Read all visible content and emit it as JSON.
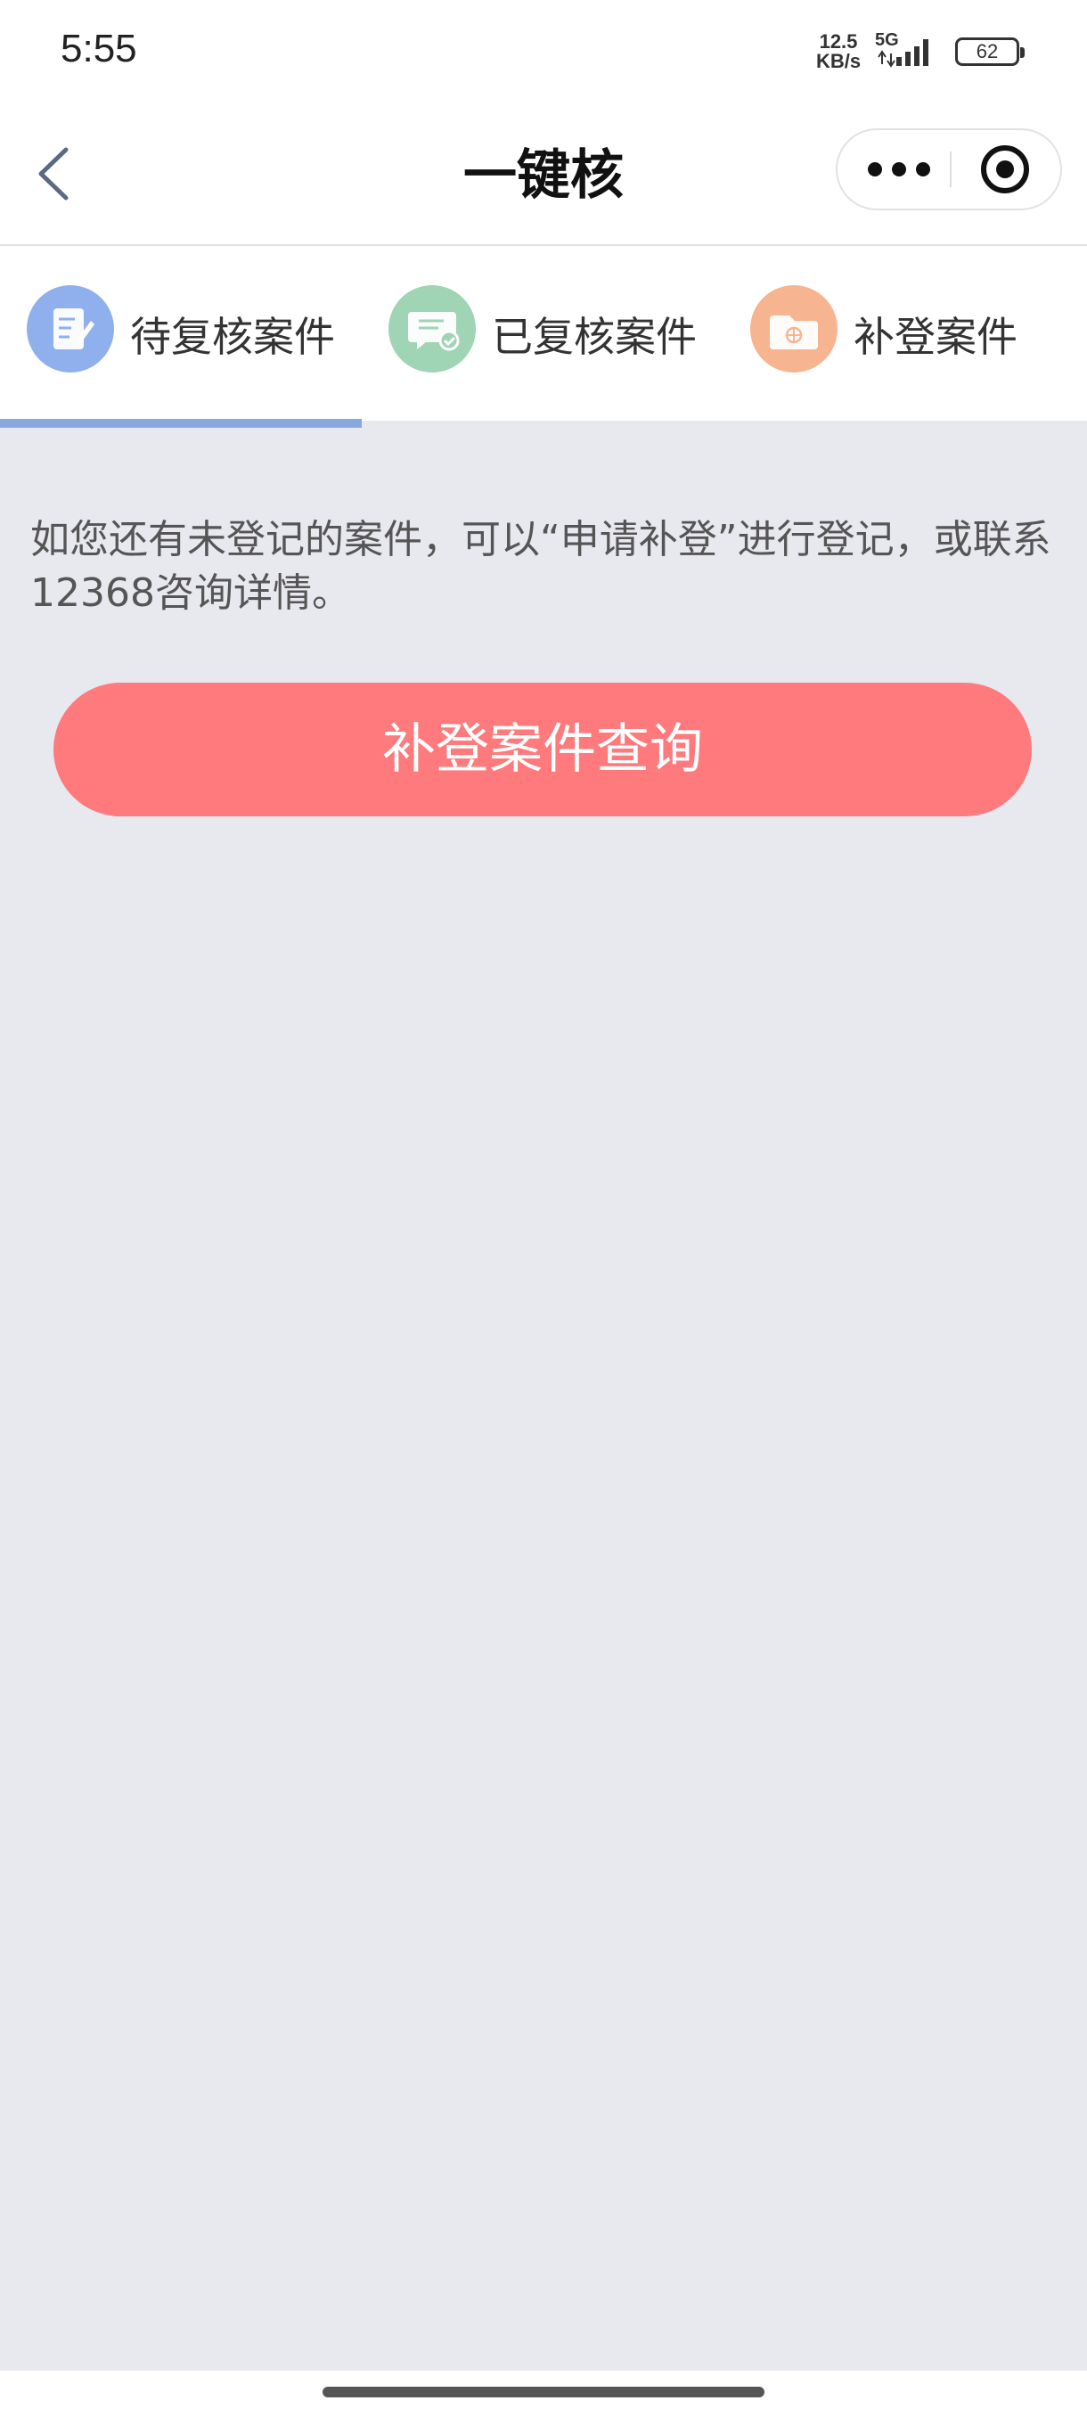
{
  "status_bar": {
    "time": "5:55",
    "net_speed_value": "12.5",
    "net_speed_unit": "KB/s",
    "network": "5G",
    "battery": "62"
  },
  "nav": {
    "title": "一键核"
  },
  "tabs": [
    {
      "label": "待复核案件",
      "icon": "notebook-edit-icon",
      "color": "#8fb0ec",
      "selected": true
    },
    {
      "label": "已复核案件",
      "icon": "message-check-icon",
      "color": "#9fd4b4",
      "selected": false
    },
    {
      "label": "补登案件",
      "icon": "folder-globe-icon",
      "color": "#f7b491",
      "selected": false
    }
  ],
  "main": {
    "notice": "如您还有未登记的案件，可以“申请补登”进行登记，或联系12368咨询详情。",
    "query_button": "补登案件查询"
  },
  "colors": {
    "background": "#e8e8ef",
    "button": "#ff7a7c",
    "tab_indicator": "#8aa8e0"
  }
}
